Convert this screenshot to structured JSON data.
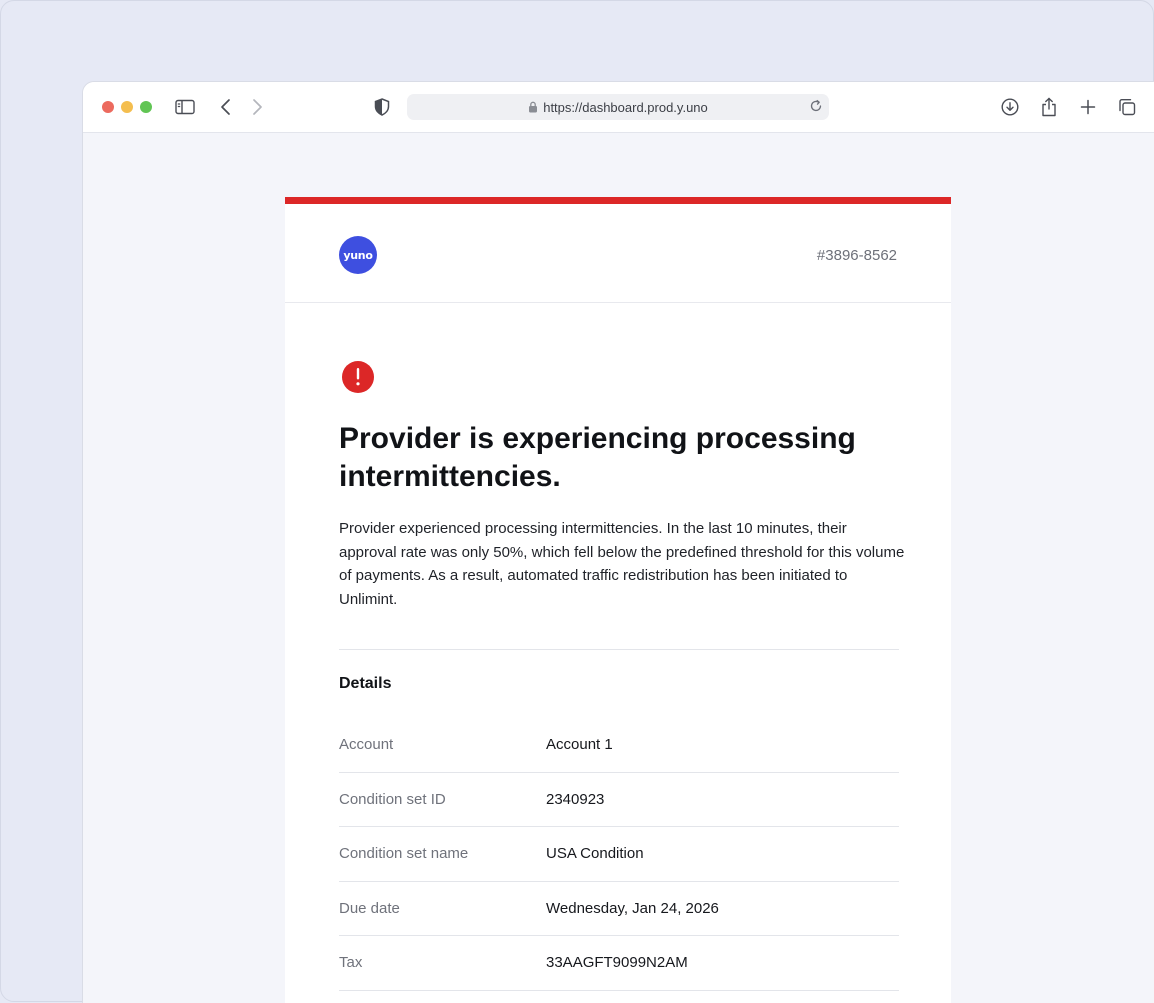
{
  "browser": {
    "url": "https://dashboard.prod.y.uno"
  },
  "header": {
    "logo_text": "yuno",
    "ticket_id": "#3896-8562"
  },
  "alert": {
    "title": "Provider is experiencing processing intermittencies.",
    "description": "Provider experienced processing intermittencies. In the last 10 minutes, their approval rate was only 50%, which fell below the predefined threshold for this volume of payments. As a result, automated traffic redistribution has been initiated to Unlimint."
  },
  "details": {
    "heading": "Details",
    "rows": [
      {
        "label": "Account",
        "value": "Account 1"
      },
      {
        "label": "Condition set ID",
        "value": "2340923"
      },
      {
        "label": "Condition set name",
        "value": "USA Condition"
      },
      {
        "label": "Due date",
        "value": "Wednesday, Jan 24, 2026"
      },
      {
        "label": "Tax",
        "value": "33AAGFT9099N2AM"
      }
    ]
  },
  "colors": {
    "accent_red": "#dc2727",
    "brand_blue": "#3e4fe0"
  },
  "icons": [
    "sidebar-icon",
    "back-icon",
    "forward-icon",
    "shield-icon",
    "lock-icon",
    "reload-icon",
    "download-icon",
    "share-icon",
    "new-tab-icon",
    "tabs-overview-icon",
    "alert-icon"
  ]
}
